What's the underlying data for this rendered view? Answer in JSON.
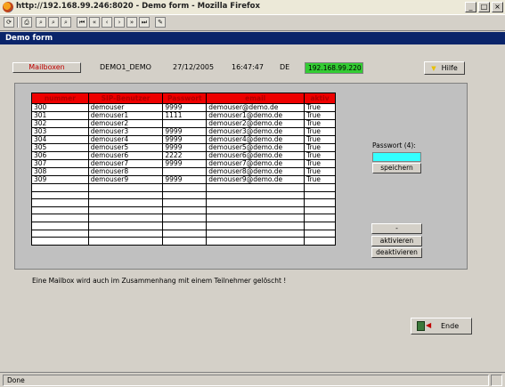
{
  "window": {
    "title": "http://192.168.99.246:8020 - Demo form - Mozilla Firefox",
    "controls": [
      "_",
      "□",
      "×"
    ]
  },
  "toolbar": {
    "buttons": [
      {
        "name": "refresh-icon",
        "glyph": "⟳"
      },
      {
        "name": "print-icon",
        "glyph": "⎙"
      },
      {
        "name": "search-icon",
        "glyph": "⌕"
      },
      {
        "name": "search-next-icon",
        "glyph": "⌕"
      },
      {
        "name": "first-record-icon",
        "glyph": "⏮"
      },
      {
        "name": "previous-page-icon",
        "glyph": "«"
      },
      {
        "name": "previous-record-icon",
        "glyph": "‹"
      },
      {
        "name": "next-record-icon",
        "glyph": "›"
      },
      {
        "name": "next-page-icon",
        "glyph": "»"
      },
      {
        "name": "last-record-icon",
        "glyph": "⏭"
      },
      {
        "name": "edit-icon",
        "glyph": "✎"
      }
    ]
  },
  "form": {
    "title": "Demo form"
  },
  "info": {
    "mailboxen_label": "Mailboxen",
    "company": "DEMO1_DEMO",
    "date": "27/12/2005",
    "time": "16:47:47",
    "language": "DE",
    "ip": "192.168.99.220",
    "help_label": "Hilfe",
    "help_icon": "question-icon"
  },
  "table": {
    "headers": [
      "nummer",
      "SIP-Benutzer",
      "Passwort",
      "email",
      "aktiv"
    ],
    "rows": [
      [
        "300",
        "demouser",
        "9999",
        "demouser@demo.de",
        "True"
      ],
      [
        "301",
        "demouser1",
        "1111",
        "demouser1@demo.de",
        "True"
      ],
      [
        "302",
        "demouser2",
        "",
        "demouser2@demo.de",
        "True"
      ],
      [
        "303",
        "demouser3",
        "9999",
        "demouser3@demo.de",
        "True"
      ],
      [
        "304",
        "demouser4",
        "9999",
        "demouser4@demo.de",
        "True"
      ],
      [
        "305",
        "demouser5",
        "9999",
        "demouser5@demo.de",
        "True"
      ],
      [
        "306",
        "demouser6",
        "2222",
        "demouser6@demo.de",
        "True"
      ],
      [
        "307",
        "demouser7",
        "9999",
        "demouser7@demo.de",
        "True"
      ],
      [
        "308",
        "demouser8",
        "",
        "demouser8@demo.de",
        "True"
      ],
      [
        "309",
        "demouser9",
        "9999",
        "demouser9@demo.de",
        "True"
      ],
      [
        "",
        "",
        "",
        "",
        ""
      ],
      [
        "",
        "",
        "",
        "",
        ""
      ],
      [
        "",
        "",
        "",
        "",
        ""
      ],
      [
        "",
        "",
        "",
        "",
        ""
      ],
      [
        "",
        "",
        "",
        "",
        ""
      ],
      [
        "",
        "",
        "",
        "",
        ""
      ],
      [
        "",
        "",
        "",
        "",
        ""
      ],
      [
        "",
        "",
        "",
        "",
        ""
      ]
    ]
  },
  "password_panel": {
    "label": "Passwort (4):",
    "value": "",
    "save_label": "speichern"
  },
  "actions": {
    "dash_label": "-",
    "activate_label": "aktivieren",
    "deactivate_label": "deaktivieren"
  },
  "note": "Eine Mailbox wird auch im Zusammenhang mit einem Teilnehmer gelöscht !",
  "end_button": {
    "label": "Ende",
    "icon": "exit-door-icon"
  },
  "status": {
    "text": "Done"
  },
  "colors": {
    "header_bg": "#ee0000",
    "form_title_bg": "#0a246a",
    "ip_badge": "#33cc33",
    "password_field": "#33ffff",
    "mailboxen_text": "#c00000"
  }
}
